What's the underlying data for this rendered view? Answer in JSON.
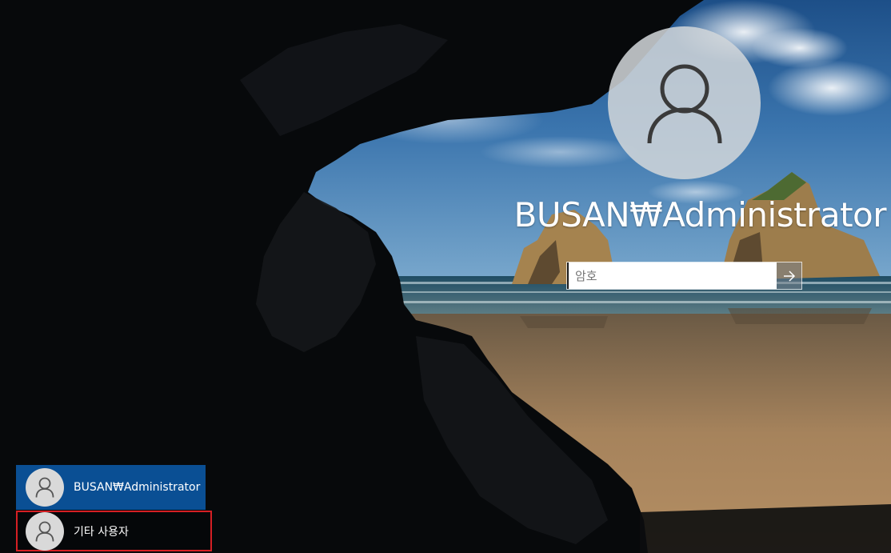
{
  "login": {
    "username": "BUSAN₩Administrator",
    "password_placeholder": "암호",
    "password_value": "",
    "submit_icon": "arrow-right-icon",
    "avatar_icon": "user-icon"
  },
  "user_list": {
    "items": [
      {
        "label": "BUSAN₩Administrator",
        "icon": "user-icon",
        "selected": true
      },
      {
        "label": "기타 사용자",
        "icon": "user-icon",
        "selected": false
      }
    ]
  },
  "colors": {
    "selected_tile": "#0a4f94",
    "highlight_border": "#d51f24"
  }
}
